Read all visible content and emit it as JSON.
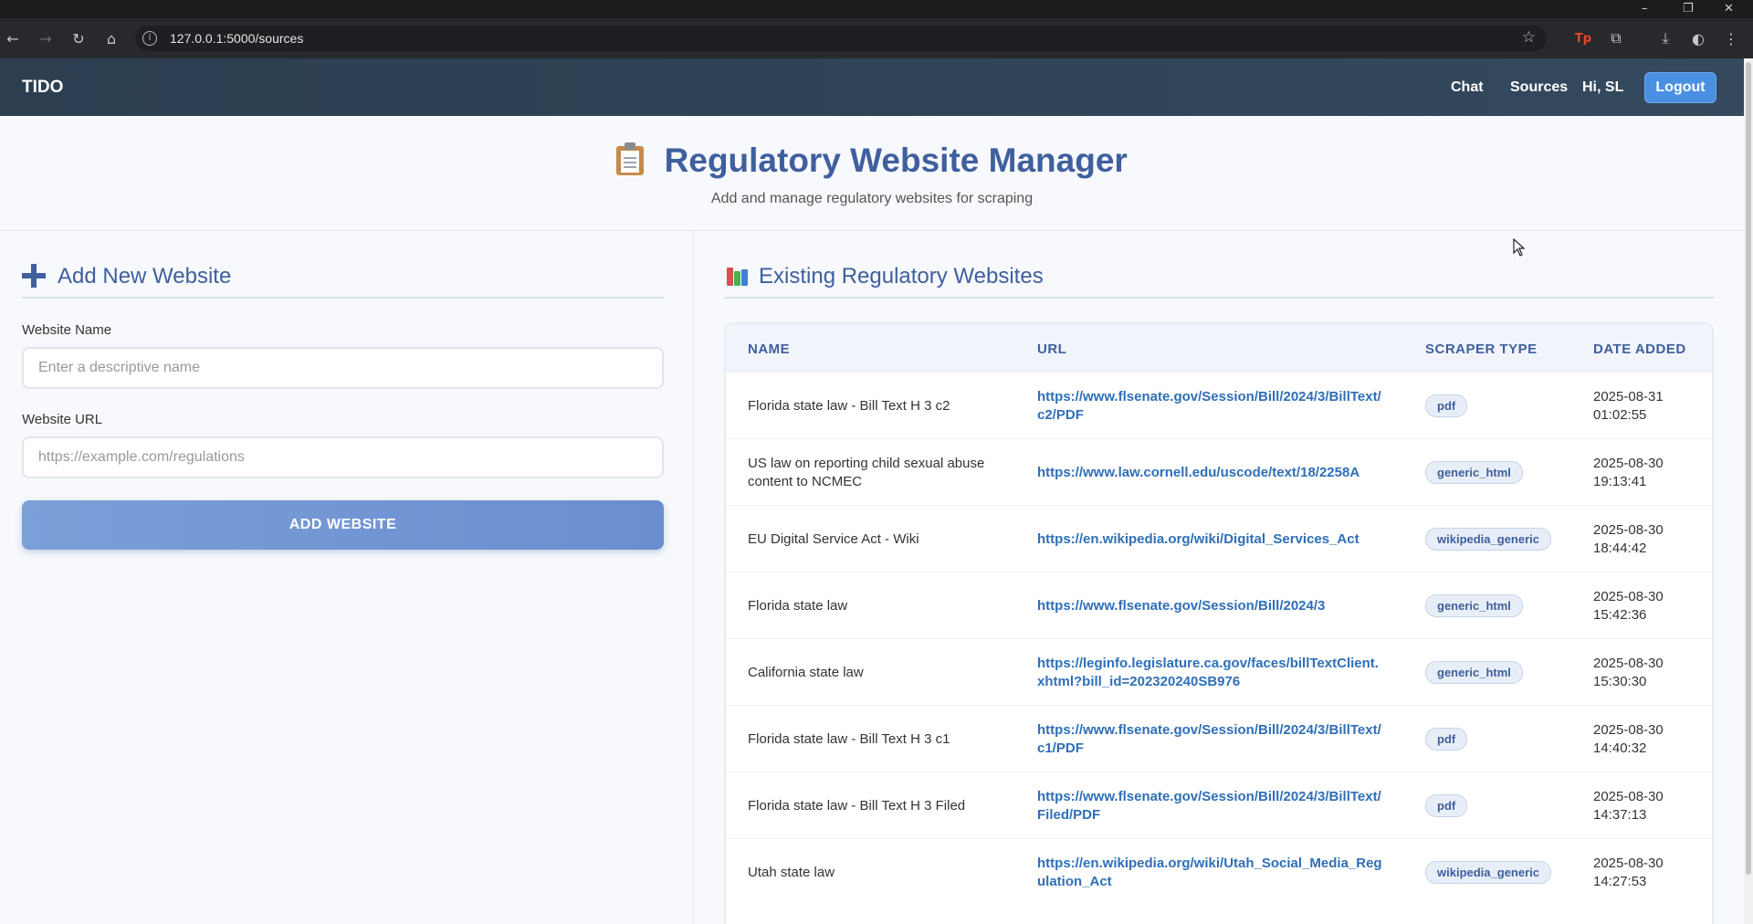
{
  "browser": {
    "url": "127.0.0.1:5000/sources",
    "window_controls": {
      "minimize": "–",
      "restore": "❐",
      "close": "✕"
    }
  },
  "navbar": {
    "brand": "TIDO",
    "links": {
      "chat": "Chat",
      "sources": "Sources"
    },
    "greeting": "Hi, SL",
    "logout_label": "Logout"
  },
  "header": {
    "title": "Regulatory Website Manager",
    "subtitle": "Add and manage regulatory websites for scraping",
    "icon": "clipboard-icon"
  },
  "add_form": {
    "title": "Add New Website",
    "name_label": "Website Name",
    "name_placeholder": "Enter a descriptive name",
    "name_value": "",
    "url_label": "Website URL",
    "url_placeholder": "https://example.com/regulations",
    "url_value": "",
    "submit_label": "ADD WEBSITE"
  },
  "existing": {
    "title": "Existing Regulatory Websites",
    "icon": "books-icon",
    "columns": {
      "name": "NAME",
      "url": "URL",
      "scraper_type": "SCRAPER TYPE",
      "date_added": "DATE ADDED"
    },
    "rows": [
      {
        "name": "Florida state law - Bill Text H 3 c2",
        "url": "https://www.flsenate.gov/Session/Bill/2024/3/BillText/c2/PDF",
        "type": "pdf",
        "date": "2025-08-31",
        "time": "01:02:55"
      },
      {
        "name": "US law on reporting child sexual abuse content to NCMEC",
        "url": "https://www.law.cornell.edu/uscode/text/18/2258A",
        "type": "generic_html",
        "date": "2025-08-30",
        "time": "19:13:41"
      },
      {
        "name": "EU Digital Service Act - Wiki",
        "url": "https://en.wikipedia.org/wiki/Digital_Services_Act",
        "type": "wikipedia_generic",
        "date": "2025-08-30",
        "time": "18:44:42"
      },
      {
        "name": "Florida state law",
        "url": "https://www.flsenate.gov/Session/Bill/2024/3",
        "type": "generic_html",
        "date": "2025-08-30",
        "time": "15:42:36"
      },
      {
        "name": "California state law",
        "url": "https://leginfo.legislature.ca.gov/faces/billTextClient.xhtml?bill_id=202320240SB976",
        "type": "generic_html",
        "date": "2025-08-30",
        "time": "15:30:30"
      },
      {
        "name": "Florida state law - Bill Text H 3 c1",
        "url": "https://www.flsenate.gov/Session/Bill/2024/3/BillText/c1/PDF",
        "type": "pdf",
        "date": "2025-08-30",
        "time": "14:40:32"
      },
      {
        "name": "Florida state law - Bill Text H 3 Filed",
        "url": "https://www.flsenate.gov/Session/Bill/2024/3/BillText/Filed/PDF",
        "type": "pdf",
        "date": "2025-08-30",
        "time": "14:37:13"
      },
      {
        "name": "Utah state law",
        "url": "https://en.wikipedia.org/wiki/Utah_Social_Media_Regulation_Act",
        "type": "wikipedia_generic",
        "date": "2025-08-30",
        "time": "14:27:53"
      }
    ]
  },
  "colors": {
    "navbar": "#2c3e50",
    "accent": "#3f5f9e",
    "link": "#2f6fb8",
    "button": "#6a8ed0",
    "logout": "#4a90e2"
  }
}
